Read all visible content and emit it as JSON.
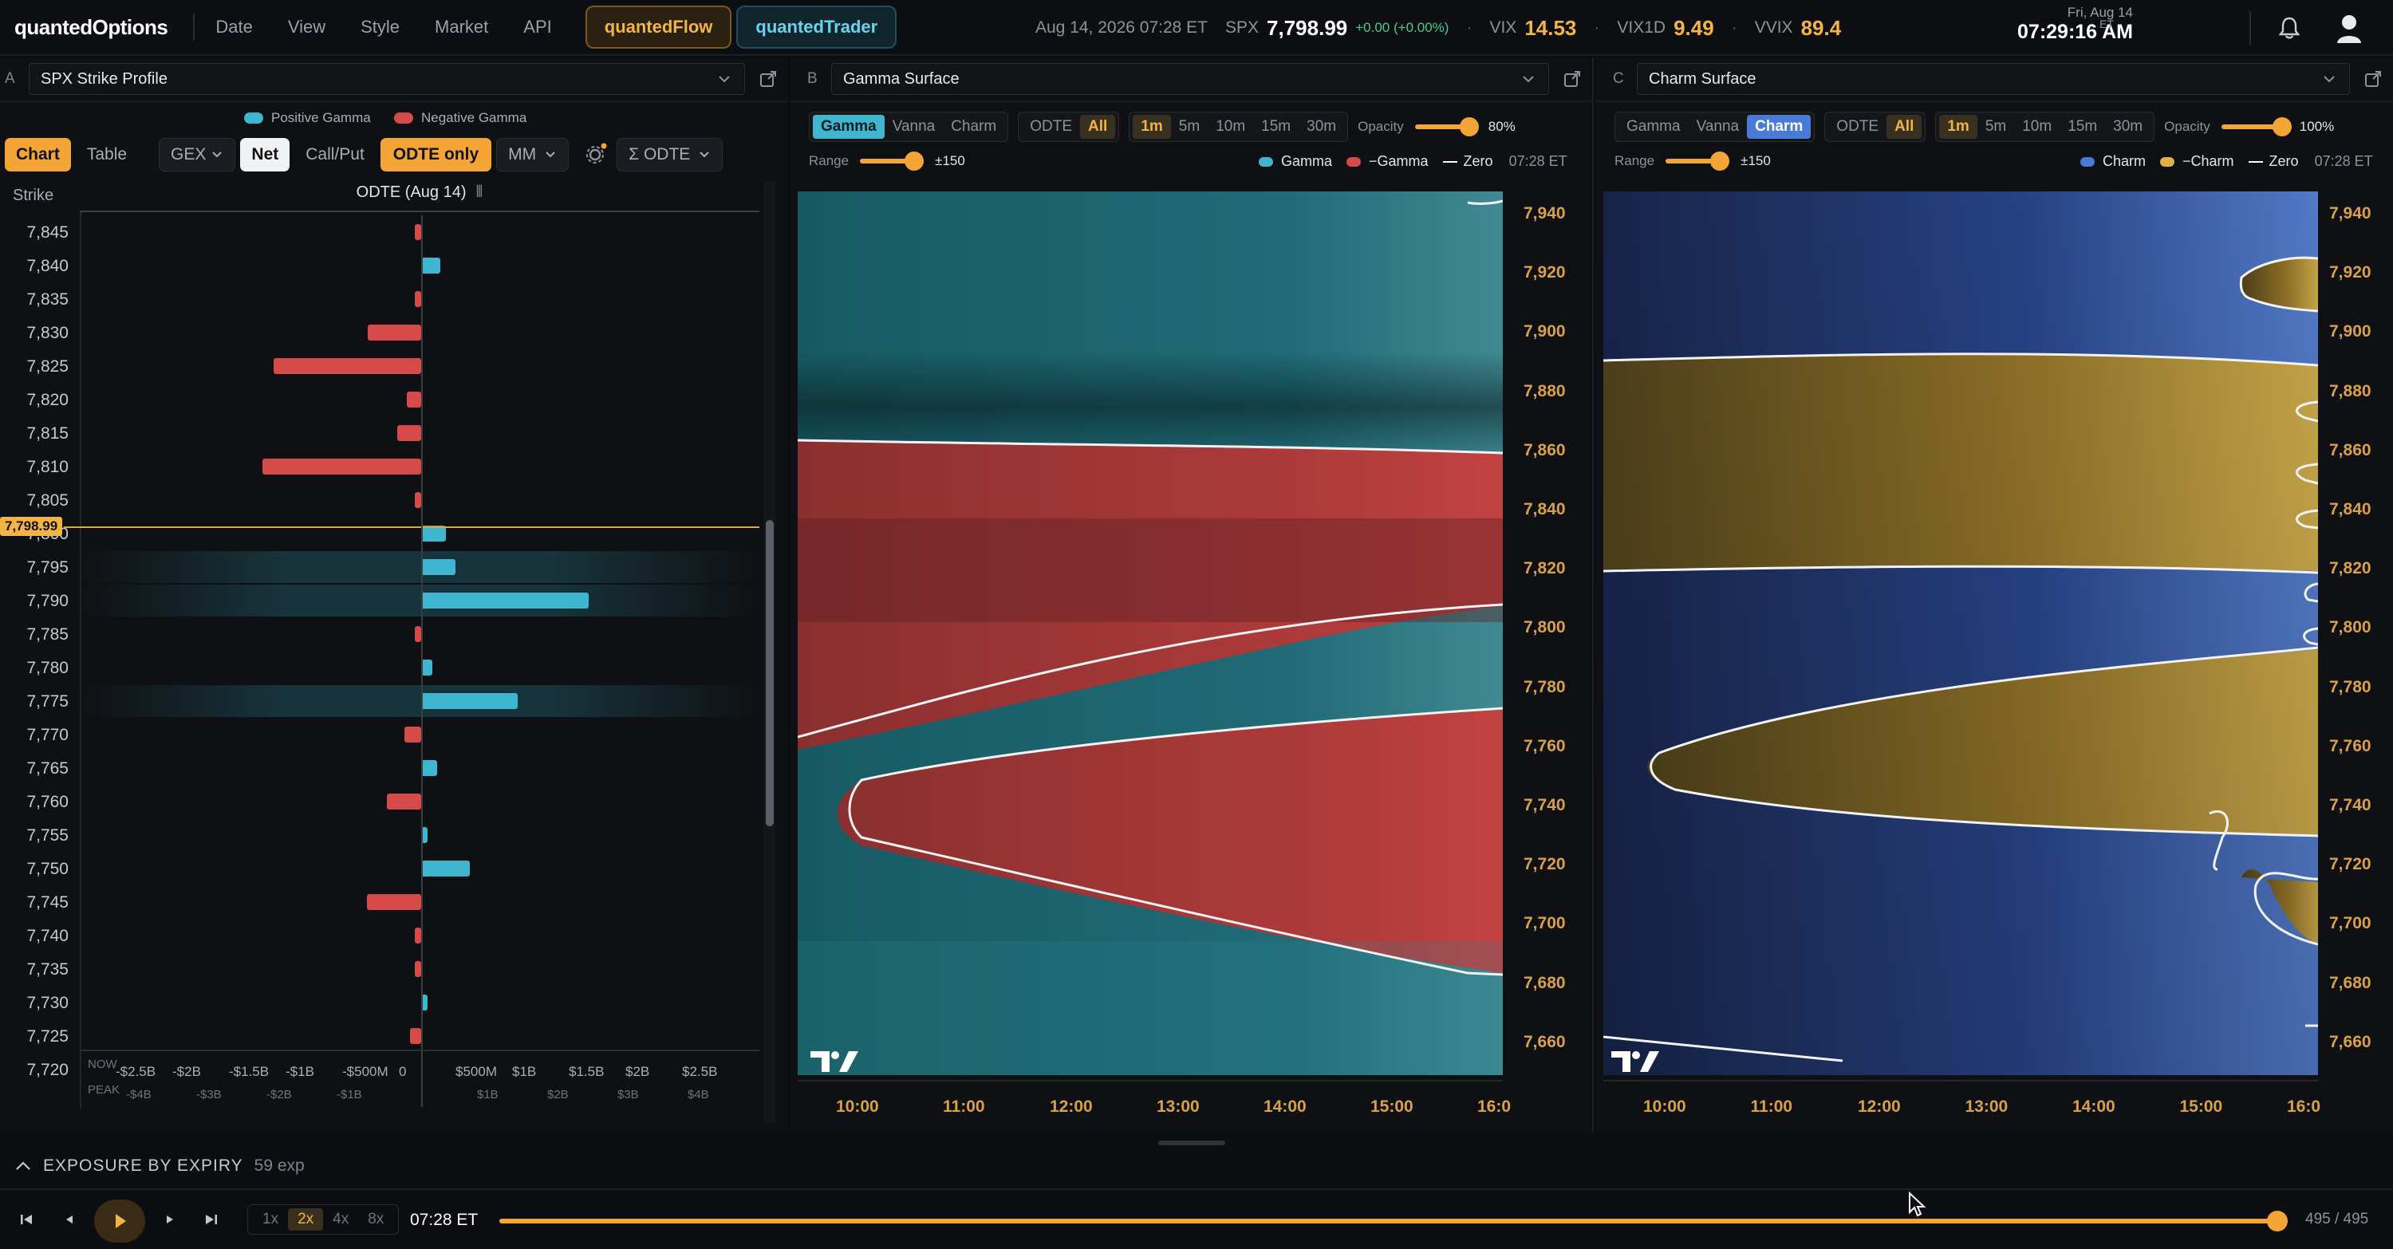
{
  "topbar": {
    "logo": "quantedOptions",
    "nav": [
      "Date",
      "View",
      "Style",
      "Market",
      "API"
    ],
    "flow_label": "quantedFlow",
    "trader_label": "quantedTrader",
    "datetime": "Aug 14, 2026 07:28 ET",
    "spx_label": "SPX",
    "spx_value": "7,798.99",
    "spx_change": "+0.00 (+0.00%)",
    "vix_label": "VIX",
    "vix_value": "14.53",
    "vix1d_label": "VIX1D",
    "vix1d_value": "9.49",
    "vvix_label": "VVIX",
    "vvix_value": "89.4",
    "clock_date": "Fri, Aug 14",
    "clock_time": "07:29:16 AM",
    "clock_tz": "ET"
  },
  "panel_a": {
    "letter": "A",
    "title": "SPX Strike Profile",
    "legend_pos": "Positive Gamma",
    "legend_neg": "Negative Gamma",
    "tab_chart": "Chart",
    "tab_table": "Table",
    "gex": "GEX",
    "net": "Net",
    "callput": "Call/Put",
    "odte_only": "ODTE only",
    "mm": "MM",
    "sum_odte": "Σ ODTE",
    "strike_hdr": "Strike",
    "odte_hdr": "ODTE (Aug 14)",
    "price_tag": "7,798.99",
    "x_now_label": "NOW",
    "x_peak_label": "PEAK",
    "x_ticks": [
      "-$2.5B",
      "-$2B",
      "-$1.5B",
      "-$1B",
      "-$500M",
      "0",
      "$500M",
      "$1B",
      "$1.5B",
      "$2B",
      "$2.5B"
    ],
    "x_peak_ticks": [
      "-$4B",
      "-$3B",
      "-$2B",
      "-$1B",
      "$1B",
      "$2B",
      "$3B",
      "$4B"
    ],
    "strikes": [
      "7,845",
      "7,840",
      "7,835",
      "7,830",
      "7,825",
      "7,820",
      "7,815",
      "7,810",
      "7,805",
      "7,800",
      "7,795",
      "7,790",
      "7,785",
      "7,780",
      "7,775",
      "7,770",
      "7,765",
      "7,760",
      "7,755",
      "7,750",
      "7,745",
      "7,740",
      "7,735",
      "7,730",
      "7,725",
      "7,720"
    ],
    "gex_values_b": [
      -0.03,
      0.17,
      -0.02,
      -0.47,
      -1.3,
      -0.13,
      -0.21,
      -1.4,
      -0.03,
      0.22,
      0.3,
      1.48,
      -0.02,
      0.1,
      0.85,
      -0.15,
      0.14,
      -0.3,
      0.04,
      0.43,
      -0.48,
      -0.02,
      -0.03,
      0.04,
      -0.1,
      0.0
    ]
  },
  "panel_b": {
    "letter": "B",
    "title": "Gamma Surface",
    "greeks": [
      "Gamma",
      "Vanna",
      "Charm"
    ],
    "scope": [
      "ODTE",
      "All"
    ],
    "intervals": [
      "1m",
      "5m",
      "10m",
      "15m",
      "30m"
    ],
    "opacity_label": "Opacity",
    "opacity_value": "80%",
    "range_label": "Range",
    "range_value": "±150",
    "legend": [
      "Gamma",
      "−Gamma",
      "Zero"
    ],
    "stamp": "07:28 ET",
    "y_ticks": [
      "7,940",
      "7,920",
      "7,900",
      "7,880",
      "7,860",
      "7,840",
      "7,820",
      "7,800",
      "7,780",
      "7,760",
      "7,740",
      "7,720",
      "7,700",
      "7,680",
      "7,660"
    ],
    "x_ticks": [
      "10:00",
      "11:00",
      "12:00",
      "13:00",
      "14:00",
      "15:00",
      "16:0"
    ]
  },
  "panel_c": {
    "letter": "C",
    "title": "Charm Surface",
    "greeks": [
      "Gamma",
      "Vanna",
      "Charm"
    ],
    "scope": [
      "ODTE",
      "All"
    ],
    "intervals": [
      "1m",
      "5m",
      "10m",
      "15m",
      "30m"
    ],
    "opacity_label": "Opacity",
    "opacity_value": "100%",
    "range_label": "Range",
    "range_value": "±150",
    "legend": [
      "Charm",
      "−Charm",
      "Zero"
    ],
    "stamp": "07:28 ET",
    "y_ticks": [
      "7,940",
      "7,920",
      "7,900",
      "7,880",
      "7,860",
      "7,840",
      "7,820",
      "7,800",
      "7,780",
      "7,760",
      "7,740",
      "7,720",
      "7,700",
      "7,680",
      "7,660"
    ],
    "x_ticks": [
      "10:00",
      "11:00",
      "12:00",
      "13:00",
      "14:00",
      "15:00",
      "16:0"
    ]
  },
  "bottom": {
    "exposure_label": "EXPOSURE BY EXPIRY",
    "exposure_count": "59 exp",
    "speeds": [
      "1x",
      "2x",
      "4x",
      "8x"
    ],
    "time": "07:28 ET",
    "progress_fraction": 1.0,
    "count": "495 / 495"
  },
  "colors": {
    "accent": "#f4a535",
    "pos": "#3fb6cf",
    "neg": "#d64a4a",
    "charm_pos": "#4a7ad8",
    "charm_neg": "#e0b040"
  }
}
